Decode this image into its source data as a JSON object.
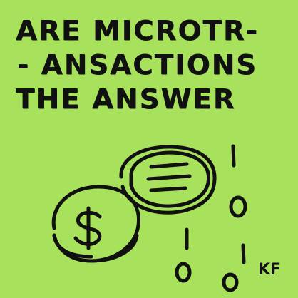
{
  "note": {
    "background": "#a8e25c",
    "ink": "#111111",
    "lines": [
      "ARE MICROTR-",
      "- ANSACTIONS",
      "THE ANSWER"
    ],
    "signature": "KF"
  },
  "doodle": {
    "coin_front_icon": "dollar-sign-icon",
    "coin_back_icon": "three-lines-icon",
    "binary_digits": [
      "1",
      "0",
      "1",
      "0",
      "1",
      "0"
    ]
  }
}
